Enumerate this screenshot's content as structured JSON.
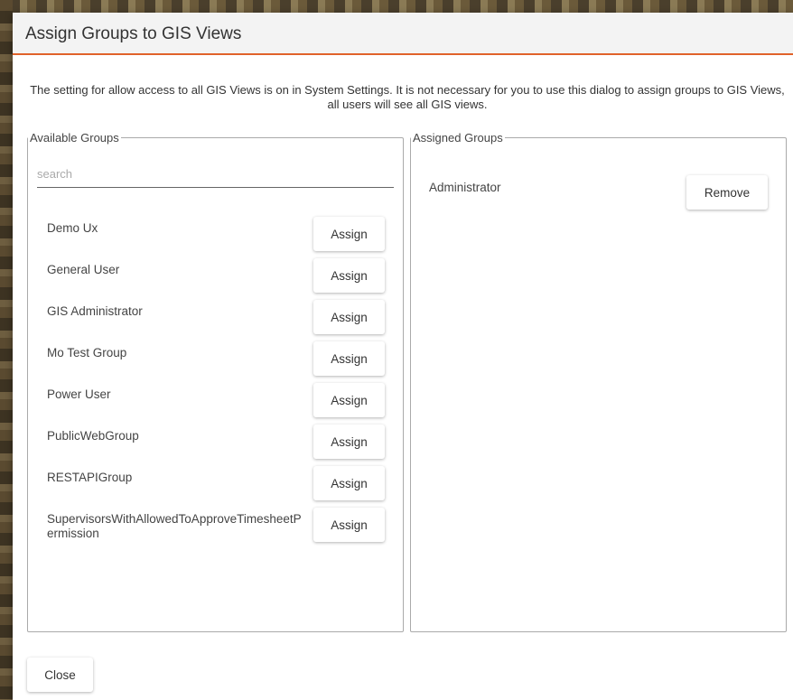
{
  "dialog": {
    "title": "Assign Groups to GIS Views",
    "notice": "The setting for allow access to all GIS Views is on in System Settings. It is not necessary for you to use this dialog to assign groups to GIS Views, all users will see all GIS views.",
    "close_label": "Close"
  },
  "available": {
    "legend": "Available Groups",
    "search_placeholder": "search",
    "assign_label": "Assign",
    "groups": [
      {
        "name": "Demo Ux"
      },
      {
        "name": "General User"
      },
      {
        "name": "GIS Administrator"
      },
      {
        "name": "Mo Test Group"
      },
      {
        "name": "Power User"
      },
      {
        "name": "PublicWebGroup"
      },
      {
        "name": "RESTAPIGroup"
      },
      {
        "name": "SupervisorsWithAllowedToApproveTimesheetPermission"
      }
    ]
  },
  "assigned": {
    "legend": "Assigned Groups",
    "remove_label": "Remove",
    "groups": [
      {
        "name": "Administrator"
      }
    ]
  },
  "colors": {
    "accent": "#e0622a",
    "header_bg": "#f3f3f3"
  }
}
